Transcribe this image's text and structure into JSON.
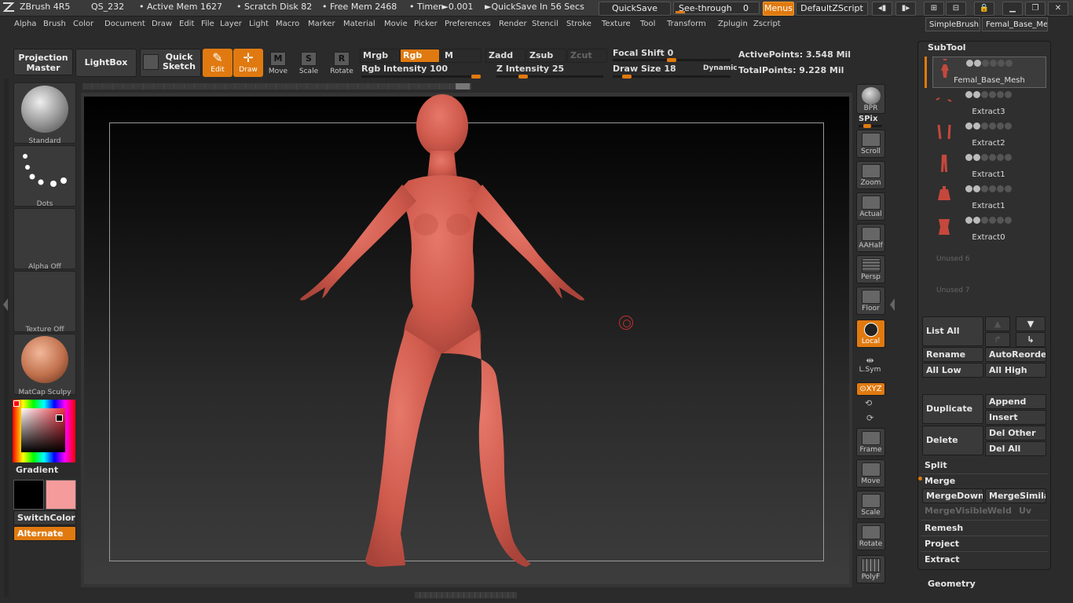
{
  "titlebar": {
    "app": "ZBrush 4R5",
    "doc": "QS_232",
    "active_mem": "• Active Mem 1627",
    "scratch": "• Scratch Disk 82",
    "free_mem": "• Free Mem 2468",
    "timer": "• Timer►0.001",
    "quicksave_msg": "►QuickSave In 56 Secs",
    "quicksave_btn": "QuickSave",
    "seethrough": "See-through",
    "seethrough_val": "0",
    "menus": "Menus",
    "script": "DefaultZScript"
  },
  "menubar": [
    "Alpha",
    "Brush",
    "Color",
    "Document",
    "Draw",
    "Edit",
    "File",
    "Layer",
    "Light",
    "Macro",
    "Marker",
    "Material",
    "Movie",
    "Picker",
    "Preferences",
    "Render",
    "Stencil",
    "Stroke",
    "Texture",
    "Tool",
    "Transform",
    "Zplugin",
    "Zscript"
  ],
  "top_tabs": {
    "simple": "SimpleBrush",
    "mesh": "Femal_Base_Mes"
  },
  "toolbar": {
    "projection_master": "Projection Master",
    "lightbox": "LightBox",
    "quick_sketch": "Quick Sketch",
    "edit": "Edit",
    "draw": "Draw",
    "move": "Move",
    "scale": "Scale",
    "rotate": "Rotate",
    "mrgb": "Mrgb",
    "rgb": "Rgb",
    "m": "M",
    "zadd": "Zadd",
    "zsub": "Zsub",
    "zcut": "Zcut",
    "rgb_intensity": "Rgb Intensity 100",
    "z_intensity": "Z Intensity 25",
    "focal_shift": "Focal Shift 0",
    "draw_size": "Draw Size 18",
    "dynamic": "Dynamic",
    "active_points": "ActivePoints: 3.548 Mil",
    "total_points": "TotalPoints: 9.228 Mil",
    "rgb_intensity_val": 100,
    "z_intensity_val": 25,
    "focal_shift_val": 0,
    "draw_size_val": 18
  },
  "leftpanel": {
    "standard": "Standard",
    "dots": "Dots",
    "alpha_off": "Alpha  Off",
    "texture_off": "Texture  Off",
    "matcap": "MatCap  Sculpy",
    "gradient": "Gradient",
    "switchcolor": "SwitchColor",
    "alternate": "Alternate",
    "colors": {
      "main": "#000000",
      "secondary": "#f59b9b",
      "accent": "#e07a10"
    }
  },
  "shelf": {
    "bpr": "BPR",
    "spix": "SPix",
    "scroll": "Scroll",
    "zoom": "Zoom",
    "actual": "Actual",
    "aahalf": "AAHalf",
    "persp": "Persp",
    "floor": "Floor",
    "local": "Local",
    "lsym": "L.Sym",
    "xyz": "⊙XYZ",
    "frame": "Frame",
    "move": "Move",
    "scale": "Scale",
    "rotate": "Rotate",
    "polyf": "PolyF"
  },
  "subtool": {
    "title": "SubTool",
    "items": [
      "Femal_Base_Mesh",
      "Extract3",
      "Extract2",
      "Extract1",
      "Extract1",
      "Extract0"
    ],
    "unused": [
      "Unused  6",
      "Unused  7"
    ],
    "list_all": "List  All",
    "rename": "Rename",
    "autoreorder": "AutoReorder",
    "all_low": "All  Low",
    "all_high": "All  High",
    "duplicate": "Duplicate",
    "append": "Append",
    "insert": "Insert",
    "delete": "Delete",
    "del_other": "Del  Other",
    "del_all": "Del  All",
    "split": "Split",
    "merge": "Merge",
    "mergedown": "MergeDown",
    "mergesimilar": "MergeSimilar",
    "mergevisible": "MergeVisible",
    "weld": "Weld",
    "uv": "Uv",
    "remesh": "Remesh",
    "project": "Project",
    "extract": "Extract",
    "geometry": "Geometry"
  }
}
